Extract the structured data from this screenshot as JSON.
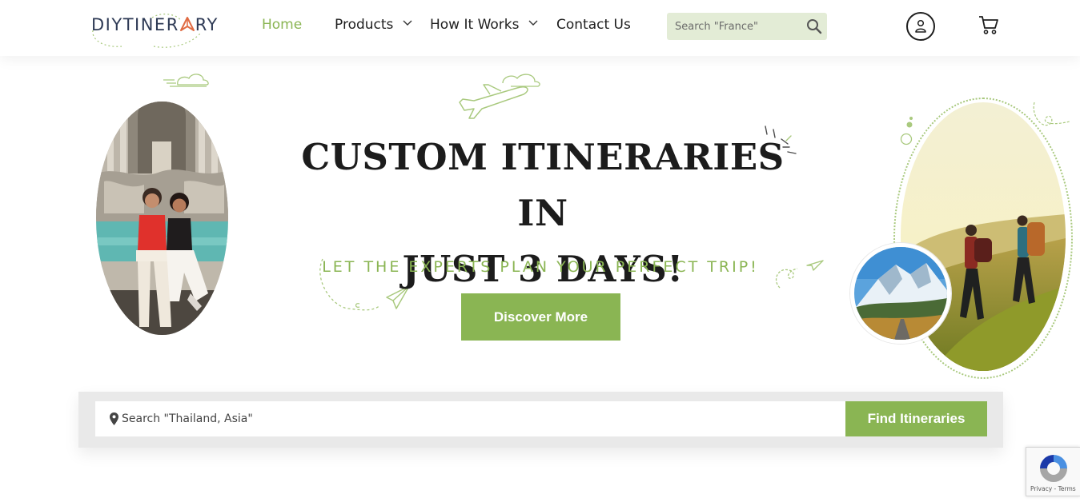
{
  "brand": {
    "logo_text_a": "DIYTINER",
    "logo_text_b": "RY",
    "accent_color": "#8ab553",
    "logo_color": "#2e3a55",
    "logo_a_color": "#e06b43"
  },
  "nav": {
    "items": [
      {
        "label": "Home",
        "active": true,
        "has_dropdown": false
      },
      {
        "label": "Products",
        "active": false,
        "has_dropdown": true
      },
      {
        "label": "How It Works",
        "active": false,
        "has_dropdown": true
      },
      {
        "label": "Contact Us",
        "active": false,
        "has_dropdown": false
      }
    ]
  },
  "header_search": {
    "placeholder": "Search \"France\"",
    "icon": "search-icon"
  },
  "header_icons": {
    "account": "user-icon",
    "cart": "cart-icon"
  },
  "hero": {
    "title_line1": "CUSTOM ITINERARIES IN",
    "title_line2": "JUST 3 DAYS!",
    "subtitle": "LET THE EXPERTS PLAN YOUR PERFECT TRIP!",
    "cta_label": "Discover More",
    "decorations": [
      "cloud-icon",
      "airplane-icon",
      "paper-plane-icon",
      "sparkle-icon"
    ]
  },
  "itinerary_search": {
    "placeholder": "Search \"Thailand, Asia\"",
    "button_label": "Find Itineraries",
    "icon": "location-pin-icon"
  },
  "recaptcha": {
    "footer_text": "Privacy - Terms"
  }
}
